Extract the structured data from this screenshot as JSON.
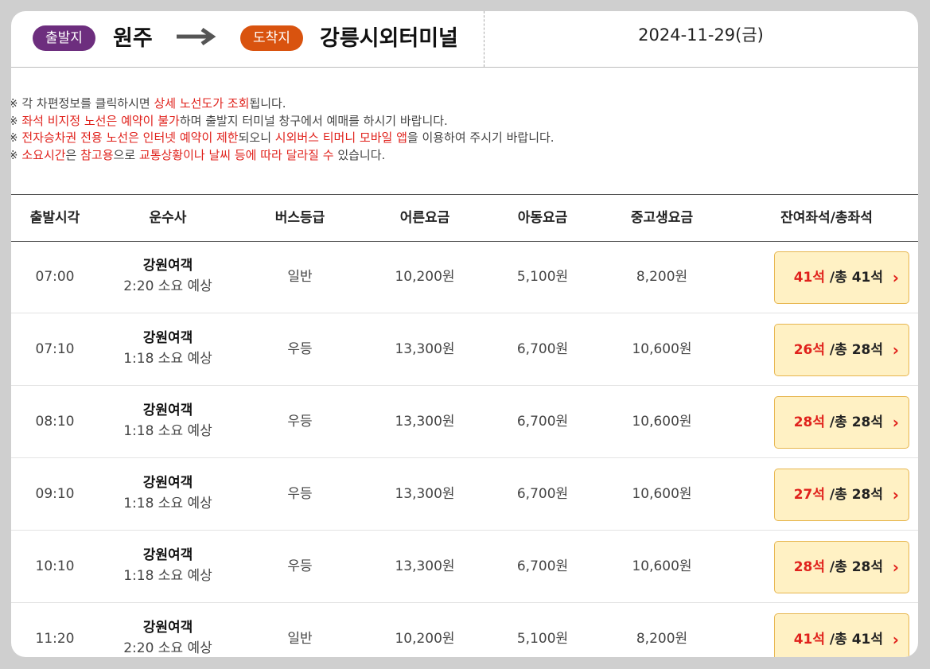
{
  "route": {
    "departure_badge": "출발지",
    "departure": "원주",
    "arrival_badge": "도착지",
    "arrival": "강릉시외터미널",
    "date": "2024-11-29(금)"
  },
  "notices": [
    [
      {
        "t": "※ 각 차편정보를 클릭하시면 "
      },
      {
        "t": "상세 노선도가 조회",
        "hl": true
      },
      {
        "t": "됩니다."
      }
    ],
    [
      {
        "t": "※ "
      },
      {
        "t": "좌석 비지정 노선은",
        "hl": true
      },
      {
        "t": " "
      },
      {
        "t": "예약이 불가",
        "hl": true
      },
      {
        "t": "하며 출발지 터미널 창구에서 예매를 하시기 바랍니다."
      }
    ],
    [
      {
        "t": "※ "
      },
      {
        "t": "전자승차권 전용 노선은",
        "hl": true
      },
      {
        "t": " "
      },
      {
        "t": "인터넷 예약이 제한",
        "hl": true
      },
      {
        "t": "되오니 "
      },
      {
        "t": "시외버스 티머니 모바일 앱",
        "hl": true
      },
      {
        "t": "을 이용하여 주시기 바랍니다."
      }
    ],
    [
      {
        "t": "※ "
      },
      {
        "t": "소요시간",
        "hl": true
      },
      {
        "t": "은 "
      },
      {
        "t": "참고용",
        "hl": true
      },
      {
        "t": "으로 "
      },
      {
        "t": "교통상황이나 날씨 등에 따라 달라질 수",
        "hl": true
      },
      {
        "t": " 있습니다."
      }
    ]
  ],
  "table": {
    "headers": {
      "time": "출발시각",
      "company": "운수사",
      "grade": "버스등급",
      "adult": "어른요금",
      "child": "아동요금",
      "teen": "중고생요금",
      "seats": "잔여좌석/총좌석"
    },
    "rows": [
      {
        "time": "07:00",
        "company": "강원여객",
        "duration": "2:20 소요 예상",
        "grade": "일반",
        "adult": "10,200원",
        "child": "5,100원",
        "teen": "8,200원",
        "remain": "41석",
        "total": " /총 41석"
      },
      {
        "time": "07:10",
        "company": "강원여객",
        "duration": "1:18 소요 예상",
        "grade": "우등",
        "adult": "13,300원",
        "child": "6,700원",
        "teen": "10,600원",
        "remain": "26석",
        "total": " /총 28석"
      },
      {
        "time": "08:10",
        "company": "강원여객",
        "duration": "1:18 소요 예상",
        "grade": "우등",
        "adult": "13,300원",
        "child": "6,700원",
        "teen": "10,600원",
        "remain": "28석",
        "total": " /총 28석"
      },
      {
        "time": "09:10",
        "company": "강원여객",
        "duration": "1:18 소요 예상",
        "grade": "우등",
        "adult": "13,300원",
        "child": "6,700원",
        "teen": "10,600원",
        "remain": "27석",
        "total": " /총 28석"
      },
      {
        "time": "10:10",
        "company": "강원여객",
        "duration": "1:18 소요 예상",
        "grade": "우등",
        "adult": "13,300원",
        "child": "6,700원",
        "teen": "10,600원",
        "remain": "28석",
        "total": " /총 28석"
      },
      {
        "time": "11:20",
        "company": "강원여객",
        "duration": "2:20 소요 예상",
        "grade": "일반",
        "adult": "10,200원",
        "child": "5,100원",
        "teen": "8,200원",
        "remain": "41석",
        "total": " /총 41석"
      }
    ]
  },
  "icons": {
    "route_arrow": "arrow-right-icon",
    "seat_chevron": "chevron-right-icon"
  },
  "colors": {
    "departure_badge": "#6d2e7e",
    "arrival_badge": "#d9530f",
    "highlight": "#e0221c",
    "seat_button_bg": "#fff1c4",
    "seat_button_border": "#e7b64f"
  }
}
